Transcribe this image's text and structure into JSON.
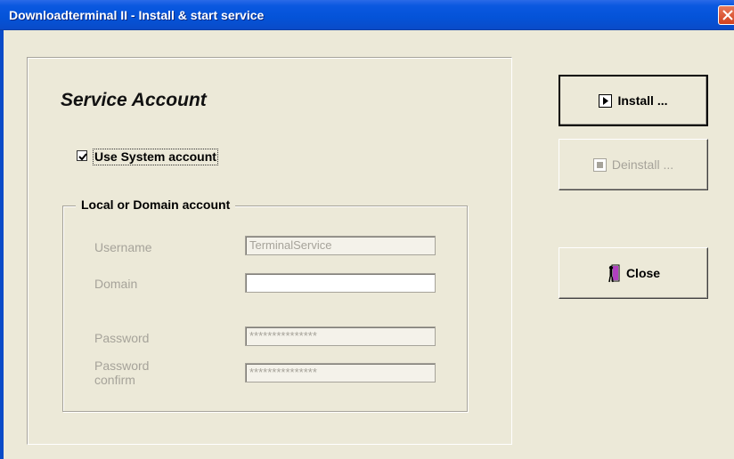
{
  "window": {
    "title": "Downloadterminal II - Install & start service"
  },
  "heading": "Service Account",
  "use_system_account": {
    "label": "Use System account",
    "checked": true
  },
  "group": {
    "title": "Local or Domain account",
    "username_label": "Username",
    "username_value": "TerminalService",
    "domain_label": "Domain",
    "domain_value": "",
    "password_label": "Password",
    "password_value": "***************",
    "password_confirm_label_line1": "Password",
    "password_confirm_label_line2": "confirm",
    "password_confirm_value": "***************"
  },
  "buttons": {
    "install": {
      "label": "Install ...",
      "icon": "play-icon"
    },
    "deinstall": {
      "label": "Deinstall ...",
      "icon": "stop-icon",
      "enabled": false
    },
    "close": {
      "label": "Close",
      "icon": "exit-door-icon"
    }
  },
  "colors": {
    "titlebar": "#0453d8",
    "window_bg": "#ece9d8",
    "disabled_text": "#a6a39a",
    "close_btn": "#d2411e"
  }
}
